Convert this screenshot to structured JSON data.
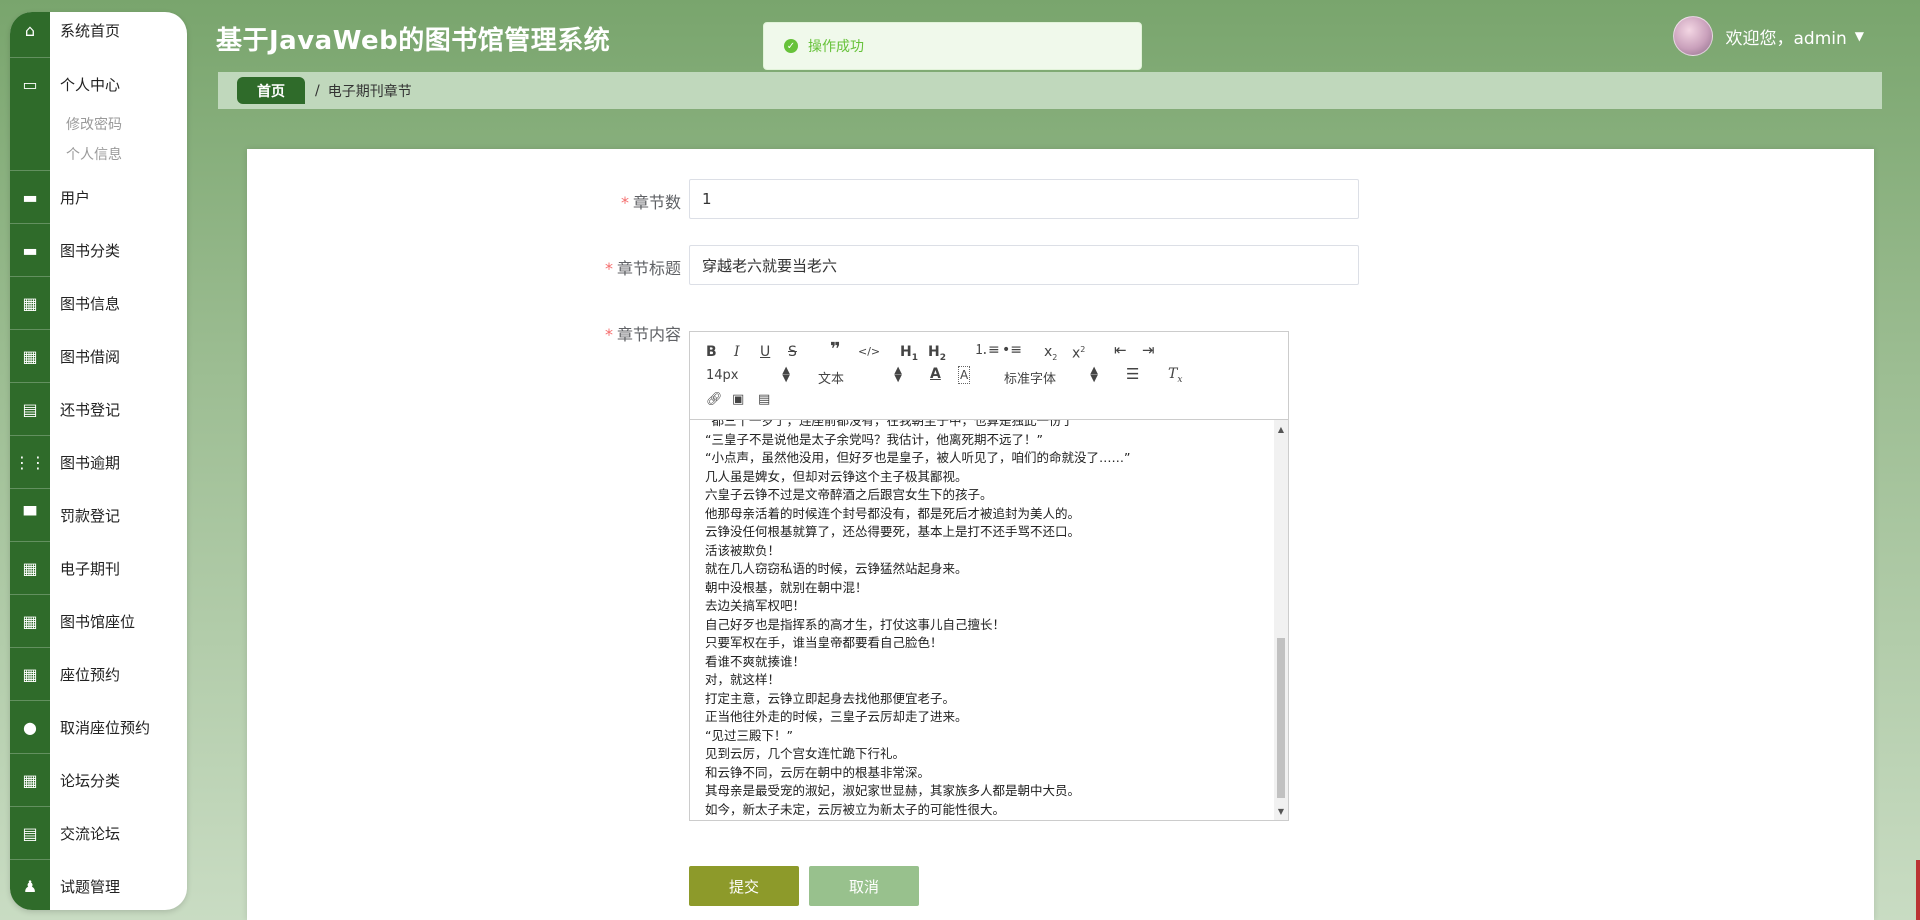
{
  "app": {
    "title": "基于JavaWeb的图书馆管理系统"
  },
  "toast": {
    "message": "操作成功"
  },
  "user": {
    "greeting": "欢迎您，admin"
  },
  "breadcrumb": {
    "home": "首页",
    "separator": "/",
    "current": "电子期刊章节"
  },
  "sidebar": {
    "items": [
      {
        "label": "系统首页",
        "icon": "home-icon"
      },
      {
        "label": "个人中心",
        "icon": "wallet-icon"
      },
      {
        "label": "用户",
        "icon": "briefcase-icon"
      },
      {
        "label": "图书分类",
        "icon": "briefcase-icon"
      },
      {
        "label": "图书信息",
        "icon": "grid-icon"
      },
      {
        "label": "图书借阅",
        "icon": "grid-icon"
      },
      {
        "label": "还书登记",
        "icon": "clipboard-icon"
      },
      {
        "label": "图书逾期",
        "icon": "apps-icon"
      },
      {
        "label": "罚款登记",
        "icon": "printer-icon"
      },
      {
        "label": "电子期刊",
        "icon": "grid-icon"
      },
      {
        "label": "图书馆座位",
        "icon": "grid-icon"
      },
      {
        "label": "座位预约",
        "icon": "grid-icon"
      },
      {
        "label": "取消座位预约",
        "icon": "bulb-icon"
      },
      {
        "label": "论坛分类",
        "icon": "grid-icon"
      },
      {
        "label": "交流论坛",
        "icon": "clipboard-icon"
      },
      {
        "label": "试题管理",
        "icon": "user-icon"
      }
    ],
    "subitems": [
      "修改密码",
      "个人信息"
    ]
  },
  "form": {
    "chapter_no": {
      "label": "章节数",
      "value": "1"
    },
    "chapter_title": {
      "label": "章节标题",
      "value": "穿越老六就要当老六"
    },
    "chapter_content": {
      "label": "章节内容"
    },
    "submit": "提交",
    "cancel": "取消"
  },
  "editor": {
    "toolbar": {
      "size": "14px",
      "header": "文本",
      "font": "标准字体"
    },
    "lines": [
      "“都三十一岁了，连座前都没有，在我朝至于中，也算是独此一份了”",
      "“三皇子不是说他是太子余党吗？我估计，他离死期不远了！”",
      "“小点声，虽然他没用，但好歹也是皇子，被人听见了，咱们的命就没了……”",
      "几人虽是婢女，但却对云铮这个主子极其鄙视。",
      "六皇子云铮不过是文帝醉酒之后跟宫女生下的孩子。",
      "他那母亲活着的时候连个封号都没有，都是死后才被追封为美人的。",
      "云铮没任何根基就算了，还怂得要死，基本上是打不还手骂不还口。",
      "活该被欺负！",
      "就在几人窃窃私语的时候，云铮猛然站起身来。",
      "朝中没根基，就别在朝中混！",
      "去边关搞军权吧！",
      "自己好歹也是指挥系的高才生，打仗这事儿自己擅长！",
      "只要军权在手，谁当皇帝都要看自己脸色！",
      "看谁不爽就揍谁！",
      "对，就这样！",
      "打定主意，云铮立即起身去找他那便宜老子。",
      "正当他往外走的时候，三皇子云厉却走了进来。",
      "“见过三殿下！”",
      "见到云厉，几个宫女连忙跪下行礼。",
      "和云铮不同，云厉在朝中的根基非常深。",
      "其母亲是最受宠的淑妃，淑妃家世显赫，其家族多人都是朝中大员。",
      "如今，新太子未定，云厉被立为新太子的可能性很大。"
    ]
  }
}
